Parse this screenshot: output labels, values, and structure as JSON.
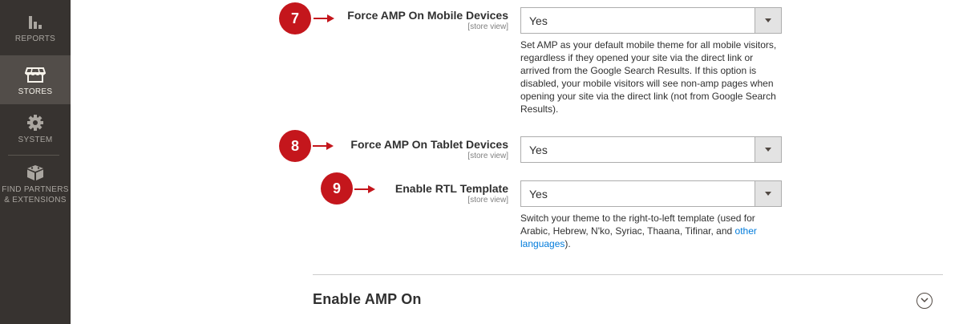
{
  "sidebar": {
    "items": [
      {
        "label": "REPORTS",
        "icon": "bar-chart-icon"
      },
      {
        "label": "STORES",
        "icon": "storefront-icon"
      },
      {
        "label": "SYSTEM",
        "icon": "gear-icon"
      },
      {
        "label": "FIND PARTNERS\n& EXTENSIONS",
        "icon": "cube-icon"
      }
    ],
    "active": "STORES",
    "active_bg": "#524d49",
    "bg": "#373330"
  },
  "fields": {
    "mobile": {
      "step": "7",
      "label": "Force AMP On Mobile Devices",
      "scope": "[store view]",
      "value": "Yes",
      "note": "Set AMP as your default mobile theme for all mobile visitors, regardless if they opened your site via the direct link or arrived from the Google Search Results. If this option is disabled, your mobile visitors will see non-amp pages when opening your site via the direct link (not from Google Search Results)."
    },
    "tablet": {
      "step": "8",
      "label": "Force AMP On Tablet Devices",
      "scope": "[store view]",
      "value": "Yes"
    },
    "rtl": {
      "step": "9",
      "label": "Enable RTL Template",
      "scope": "[store view]",
      "value": "Yes",
      "note_before": "Switch your theme to the right-to-left template (used for Arabic, Hebrew, N'ko, Syriac, Thaana, Tifinar, and ",
      "note_link": "other languages",
      "note_after": ")."
    }
  },
  "section": {
    "title": "Enable AMP On",
    "toggle_icon": "chevron-down-circle-icon"
  },
  "colors": {
    "badge": "#c4161c",
    "link": "#007bdb"
  }
}
